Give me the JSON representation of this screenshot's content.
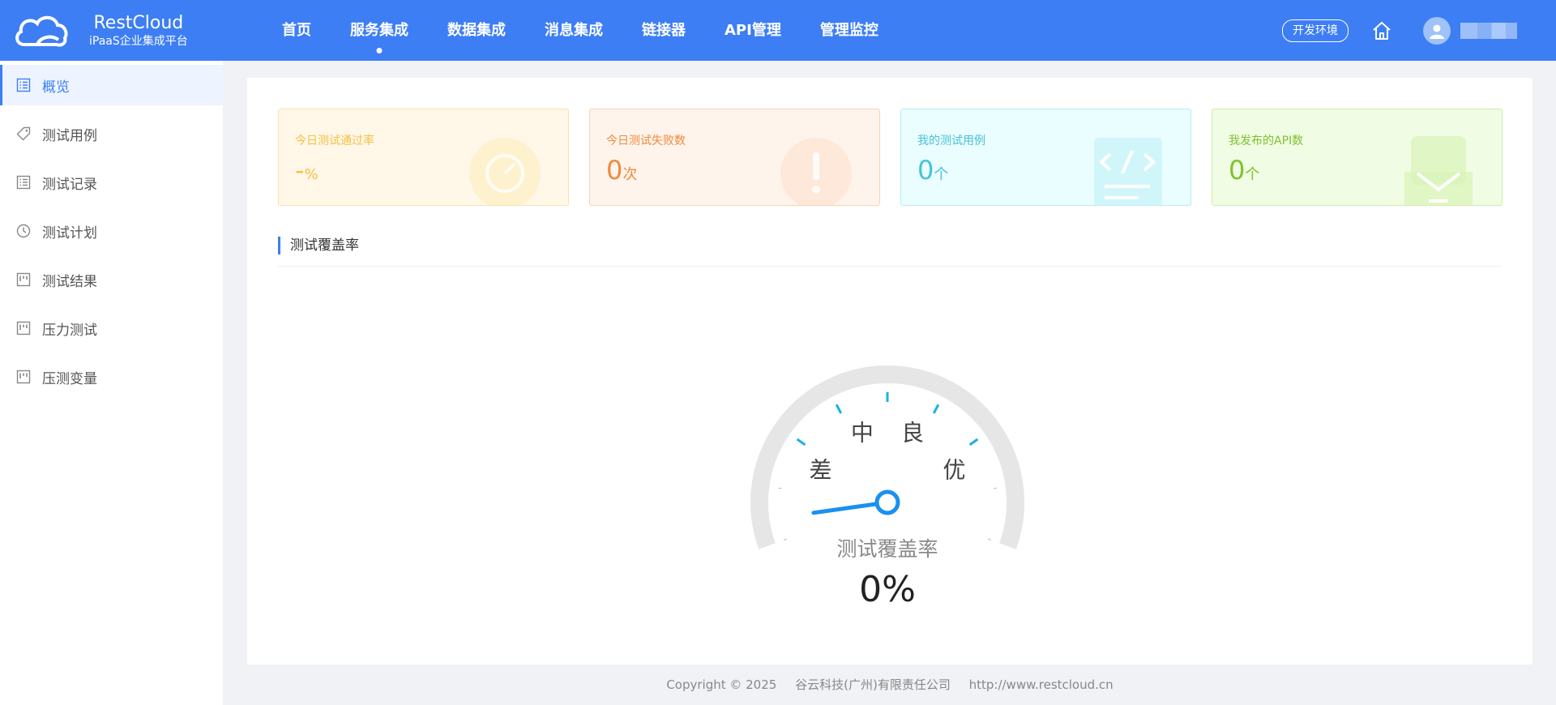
{
  "header": {
    "brand_title": "RestCloud",
    "brand_subtitle": "iPaaS企业集成平台",
    "nav": [
      {
        "label": "首页"
      },
      {
        "label": "服务集成",
        "active": true
      },
      {
        "label": "数据集成"
      },
      {
        "label": "消息集成"
      },
      {
        "label": "链接器"
      },
      {
        "label": "API管理"
      },
      {
        "label": "管理监控"
      }
    ],
    "env_label": "开发环境",
    "icons": {
      "home": "home-icon",
      "avatar": "user-avatar-icon"
    }
  },
  "sidebar": {
    "items": [
      {
        "label": "概览",
        "icon": "list-icon",
        "active": true
      },
      {
        "label": "测试用例",
        "icon": "tag-icon"
      },
      {
        "label": "测试记录",
        "icon": "list-icon"
      },
      {
        "label": "测试计划",
        "icon": "clock-icon"
      },
      {
        "label": "测试结果",
        "icon": "board-icon"
      },
      {
        "label": "压力测试",
        "icon": "board-icon"
      },
      {
        "label": "压测变量",
        "icon": "board-icon"
      }
    ]
  },
  "cards": [
    {
      "label": "今日测试通过率",
      "value": "-",
      "unit": "%",
      "color": "#f5c043",
      "bg": "#fff7e8",
      "border": "#fbe2a8",
      "icon": "gauge-icon"
    },
    {
      "label": "今日测试失败数",
      "value": "0",
      "unit": "次",
      "color": "#f08a3c",
      "bg": "#fff4ec",
      "border": "#fbd2b4",
      "icon": "alert-icon"
    },
    {
      "label": "我的测试用例",
      "value": "0",
      "unit": "个",
      "color": "#45c3d6",
      "bg": "#eafdff",
      "border": "#b5eef5",
      "icon": "code-icon"
    },
    {
      "label": "我发布的API数",
      "value": "0",
      "unit": "个",
      "color": "#7fc22e",
      "bg": "#f0fce3",
      "border": "#cdefa8",
      "icon": "api-icon"
    }
  ],
  "coverage": {
    "section_title": "测试覆盖率",
    "gauge_title": "测试覆盖率",
    "value": 0,
    "value_text": "0%",
    "labels": [
      "差",
      "中",
      "良",
      "优"
    ],
    "accent_color": "#1a90f0",
    "tick_color": "#1ab0e8"
  },
  "footer": {
    "copyright": "Copyright © 2025",
    "company": "谷云科技(广州)有限责任公司",
    "url": "http://www.restcloud.cn"
  }
}
